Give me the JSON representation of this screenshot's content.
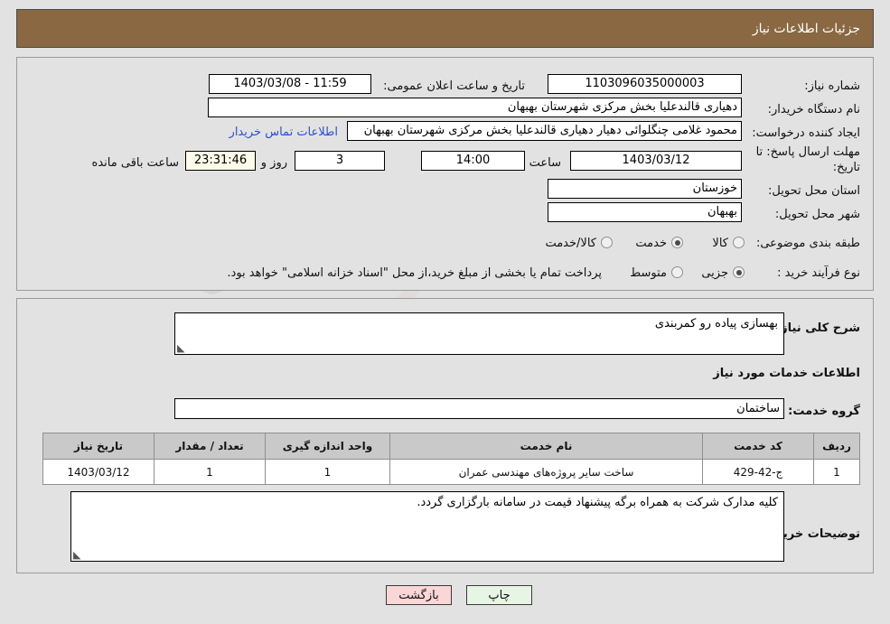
{
  "header": {
    "title": "جزئیات اطلاعات نیاز"
  },
  "top_panel": {
    "need_number": {
      "label": "شماره نیاز:",
      "value": "1103096035000003"
    },
    "announce_datetime": {
      "label": "تاریخ و ساعت اعلان عمومی:",
      "value": "11:59 - 1403/03/08"
    },
    "buyer_org": {
      "label": "نام دستگاه خریدار:",
      "value": "دهیاری قالندعلیا بخش مرکزی شهرستان بهبهان"
    },
    "request_creator": {
      "label": "ایجاد کننده درخواست:",
      "value": "محمود غلامی چنگلوائی دهیار دهیاری قالندعلیا بخش مرکزی شهرستان بهبهان"
    },
    "buyer_contact_link": "اطلاعات تماس خریدار",
    "response_deadline": {
      "label": "مهلت ارسال پاسخ: تا تاریخ:",
      "date": "1403/03/12",
      "time_label": "ساعت",
      "time": "14:00",
      "days_remaining": "3",
      "days_label": "روز و",
      "countdown": "23:31:46",
      "remaining_label": "ساعت باقی مانده"
    },
    "delivery_province": {
      "label": "استان محل تحویل:",
      "value": "خوزستان"
    },
    "delivery_city": {
      "label": "شهر محل تحویل:",
      "value": "بهبهان"
    },
    "subject_category": {
      "label": "طبقه بندی موضوعی:",
      "options": [
        "کالا",
        "خدمت",
        "کالا/خدمت"
      ],
      "selected": "خدمت"
    },
    "purchase_process": {
      "label": "نوع فرآیند خرید :",
      "options": [
        "جزیی",
        "متوسط"
      ],
      "selected": "جزیی",
      "note": "پرداخت تمام یا بخشی از مبلغ خرید،از محل \"اسناد خزانه اسلامی\" خواهد بود."
    }
  },
  "mid_panel": {
    "general_description": {
      "label": "شرح کلی نیاز:",
      "value": "بهسازی پیاده رو کمربندی"
    },
    "services_section_title": "اطلاعات خدمات مورد نیاز",
    "service_group": {
      "label": "گروه خدمت:",
      "value": "ساختمان"
    },
    "table": {
      "columns": [
        "ردیف",
        "کد خدمت",
        "نام خدمت",
        "واحد اندازه گیری",
        "تعداد / مقدار",
        "تاریخ نیاز"
      ],
      "rows": [
        {
          "row_no": "1",
          "service_code": "ج-42-429",
          "service_name": "ساخت سایر پروژه‌های مهندسی عمران",
          "unit": "1",
          "quantity": "1",
          "need_date": "1403/03/12"
        }
      ]
    },
    "buyer_comments": {
      "label": "توضیحات خریدار:",
      "value": "کلیه مدارک شرکت به همراه برگه پیشنهاد قیمت در سامانه بارگزاری گردد."
    }
  },
  "footer": {
    "print_button": "چاپ",
    "back_button": "بازگشت"
  },
  "watermark": {
    "text": "AriaTender.net"
  },
  "colors": {
    "header_bg": "#8a6842",
    "panel_bg": "#e2e2e2",
    "link": "#2b4fd0",
    "print_btn": "#e7f5e4",
    "back_btn": "#fad6d6",
    "countdown_bg": "#fbfbe8",
    "table_header_bg": "#c9c9c9"
  }
}
